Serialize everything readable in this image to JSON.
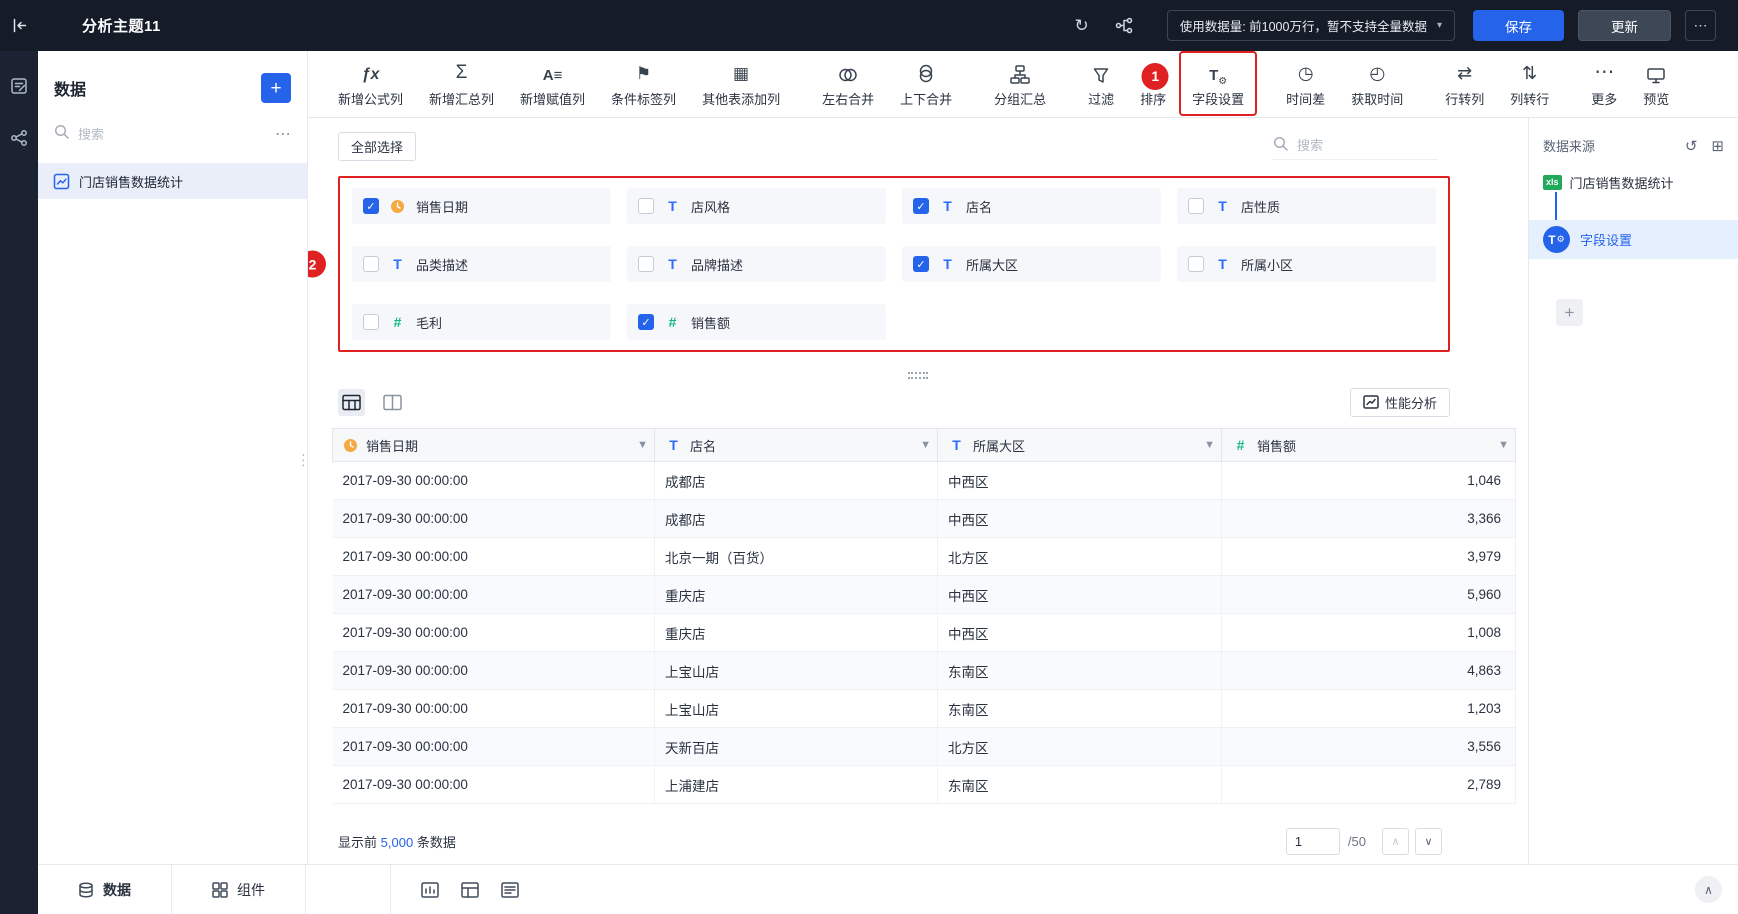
{
  "colors": {
    "topbar_bg": "#151c28",
    "accent_blue": "#2563eb",
    "annotation_red": "#e02121",
    "text_field_icon_blue": "#2b6cff",
    "date_field_icon_orange": "#f5a942",
    "number_field_icon_green": "#10b981",
    "xls_badge_green": "#21a95c",
    "selected_item_bg": "#e9eef9",
    "node_selected_bg": "#e6effd"
  },
  "topbar": {
    "title": "分析主题11",
    "refresh_icon": "refresh-icon",
    "flow_icon": "flow-icon",
    "data_limit_label": "使用数据量: 前1000万行，暂不支持全量数据",
    "save_label": "保存",
    "update_label": "更新",
    "more_label": "⋯"
  },
  "sidebar": {
    "title": "数据",
    "add_label": "+",
    "search_placeholder": "搜索",
    "items": [
      {
        "label": "门店销售数据统计",
        "icon": "line-chart-dataset-icon",
        "selected": true
      }
    ]
  },
  "toolbar": {
    "items": [
      {
        "label": "新增公式列",
        "icon": "formula-icon"
      },
      {
        "label": "新增汇总列",
        "icon": "sigma-icon"
      },
      {
        "label": "新增赋值列",
        "icon": "assign-icon"
      },
      {
        "label": "条件标签列",
        "icon": "flag-icon"
      },
      {
        "label": "其他表添加列",
        "icon": "table-add-icon"
      },
      {
        "label": "左右合并",
        "icon": "merge-left-right-icon"
      },
      {
        "label": "上下合并",
        "icon": "merge-top-bottom-icon"
      },
      {
        "label": "分组汇总",
        "icon": "group-summary-icon"
      },
      {
        "label": "过滤",
        "icon": "filter-icon"
      },
      {
        "label": "排序",
        "icon": "sort-icon"
      },
      {
        "label": "字段设置",
        "icon": "field-setting-icon",
        "highlighted": true
      },
      {
        "label": "时间差",
        "icon": "time-diff-icon"
      },
      {
        "label": "获取时间",
        "icon": "get-time-icon"
      },
      {
        "label": "行转列",
        "icon": "row-to-column-icon"
      },
      {
        "label": "列转行",
        "icon": "column-to-row-icon"
      },
      {
        "label": "更多",
        "icon": "more-icon"
      },
      {
        "label": "预览",
        "icon": "preview-icon"
      }
    ]
  },
  "field_panel": {
    "select_all_label": "全部选择",
    "search_placeholder": "搜索",
    "fields": [
      {
        "label": "销售日期",
        "type": "date",
        "checked": true
      },
      {
        "label": "店风格",
        "type": "text",
        "checked": false
      },
      {
        "label": "店名",
        "type": "text",
        "checked": true
      },
      {
        "label": "店性质",
        "type": "text",
        "checked": false
      },
      {
        "label": "品类描述",
        "type": "text",
        "checked": false
      },
      {
        "label": "品牌描述",
        "type": "text",
        "checked": false
      },
      {
        "label": "所属大区",
        "type": "text",
        "checked": true
      },
      {
        "label": "所属小区",
        "type": "text",
        "checked": false
      },
      {
        "label": "毛利",
        "type": "number",
        "checked": false
      },
      {
        "label": "销售额",
        "type": "number",
        "checked": true
      }
    ]
  },
  "table_panel": {
    "performance_label": "性能分析",
    "columns": [
      {
        "label": "销售日期",
        "type": "date"
      },
      {
        "label": "店名",
        "type": "text"
      },
      {
        "label": "所属大区",
        "type": "text"
      },
      {
        "label": "销售额",
        "type": "number"
      }
    ],
    "rows": [
      [
        "2017-09-30 00:00:00",
        "成都店",
        "中西区",
        "1,046"
      ],
      [
        "2017-09-30 00:00:00",
        "成都店",
        "中西区",
        "3,366"
      ],
      [
        "2017-09-30 00:00:00",
        "北京一期（百货）",
        "北方区",
        "3,979"
      ],
      [
        "2017-09-30 00:00:00",
        "重庆店",
        "中西区",
        "5,960"
      ],
      [
        "2017-09-30 00:00:00",
        "重庆店",
        "中西区",
        "1,008"
      ],
      [
        "2017-09-30 00:00:00",
        "上宝山店",
        "东南区",
        "4,863"
      ],
      [
        "2017-09-30 00:00:00",
        "上宝山店",
        "东南区",
        "1,203"
      ],
      [
        "2017-09-30 00:00:00",
        "天新百店",
        "北方区",
        "3,556"
      ],
      [
        "2017-09-30 00:00:00",
        "上浦建店",
        "东南区",
        "2,789"
      ]
    ],
    "footer": {
      "prefix": "显示前",
      "count": "5,000",
      "suffix": "条数据"
    },
    "pagination": {
      "page": "1",
      "total": "/50"
    }
  },
  "right_panel": {
    "title": "数据来源",
    "source_badge": "xls",
    "source_label": "门店销售数据统计",
    "node_label": "字段设置",
    "add_label": "+"
  },
  "bottom_bar": {
    "tabs": [
      {
        "label": "数据",
        "icon": "database-icon",
        "active": true
      },
      {
        "label": "组件",
        "icon": "components-icon",
        "active": false
      }
    ]
  },
  "annotations": {
    "step1": "1",
    "step2": "2"
  }
}
